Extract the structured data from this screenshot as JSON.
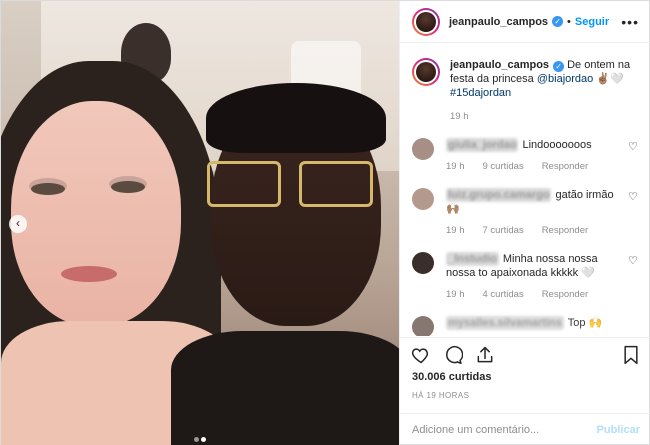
{
  "post": {
    "username": "jeanpaulo_campos",
    "follow_label": "Seguir",
    "separator": "•",
    "more_icon": "more-horizontal-icon",
    "accent_color": "#0095f6",
    "caption": {
      "username": "jeanpaulo_campos",
      "text_before": "De ontem na festa da princesa ",
      "mention": "@biajordao",
      "emoji": " ✌🏽🤍",
      "hashtag": "#15dajordan",
      "time": "19 h"
    },
    "comments": [
      {
        "username": "giulia_jordao",
        "text": "Lindooooooos",
        "time": "19 h",
        "likes": "9 curtidas",
        "reply": "Responder",
        "avatar_color": "#a88f86"
      },
      {
        "username": "luiz.grupo.camargo",
        "text": "gatão irmão 🙌🏽",
        "time": "19 h",
        "likes": "7 curtidas",
        "reply": "Responder",
        "avatar_color": "#b39a8c"
      },
      {
        "username": "_lnstudio",
        "text": "Minha nossa nossa nossa to apaixonada kkkkk 🤍",
        "time": "19 h",
        "likes": "4 curtidas",
        "reply": "Responder",
        "avatar_color": "#3a2e2a"
      },
      {
        "username": "mysalles.silvamartins",
        "text": "Top 🙌",
        "avatar_color": "#7a6a62"
      }
    ],
    "likes": "30.006 curtidas",
    "posted_ago": "HÁ 19 HORAS",
    "add_comment_placeholder": "Adicione um comentário...",
    "publish_label": "Publicar",
    "carousel": {
      "count": 2,
      "active": 1
    }
  }
}
